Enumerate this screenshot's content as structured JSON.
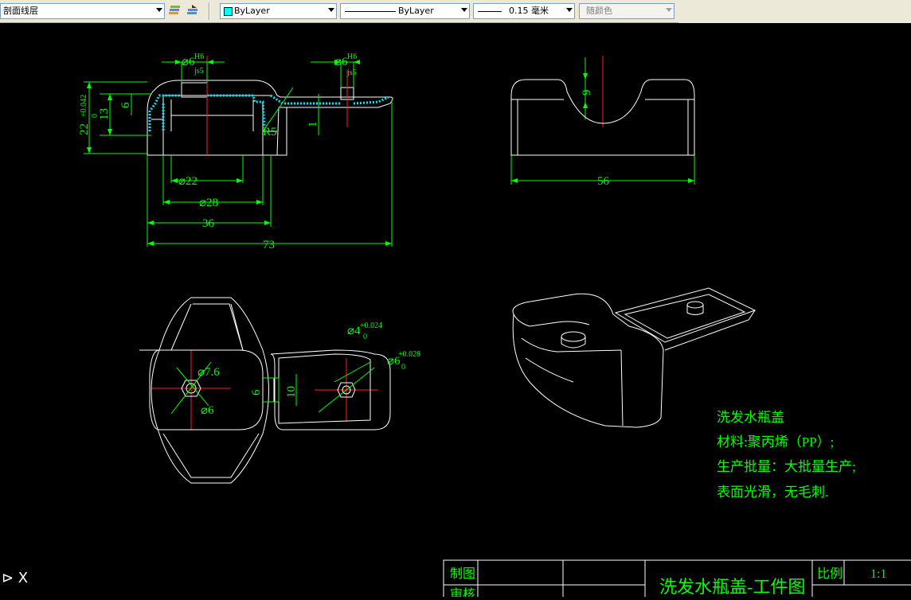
{
  "toolbar": {
    "layer_combo": "剖面线层",
    "color_combo": "ByLayer",
    "linetype_combo": "ByLayer",
    "lineweight_combo": "0.15 毫米",
    "plotstyle_combo": "随颜色"
  },
  "drawing": {
    "dims_top": {
      "d6_h6_left": "⌀6",
      "h6_tol": "H6",
      "js5_tol": "js5",
      "d6_h6_right": "⌀6",
      "tol_22": "+0.042",
      "tol_22_low": "0",
      "d22_left": "22",
      "d13": "13",
      "d6_v": "6",
      "d1": "1",
      "r5": "R5",
      "d22": "⌀22",
      "d28": "⌀28",
      "d36": "36",
      "d73": "73",
      "d9": "9",
      "d56": "56"
    },
    "dims_bottom": {
      "d7_6": "⌀7.6",
      "d6_hex": "⌀6",
      "d6_v": "6",
      "d10_v": "10",
      "d4": "⌀4",
      "d4_tol": "+0.024",
      "d4_tol_low": "0",
      "d6_right": "⌀6",
      "d6_right_tol": "+0.028",
      "d6_right_tol_low": "0"
    },
    "notes": {
      "title": "洗发水瓶盖",
      "material": "材料:聚丙烯（PP）;",
      "batch": "生产批量：大批量生产;",
      "surface": "表面光滑，无毛刺."
    },
    "title_block": {
      "drawn_by": "制图",
      "reviewed_by": "审核",
      "drawing_name": "洗发水瓶盖-工件图",
      "scale_label": "比例",
      "scale_value": "1:1"
    }
  },
  "command_line": {
    "prompt": "⊳ X"
  }
}
